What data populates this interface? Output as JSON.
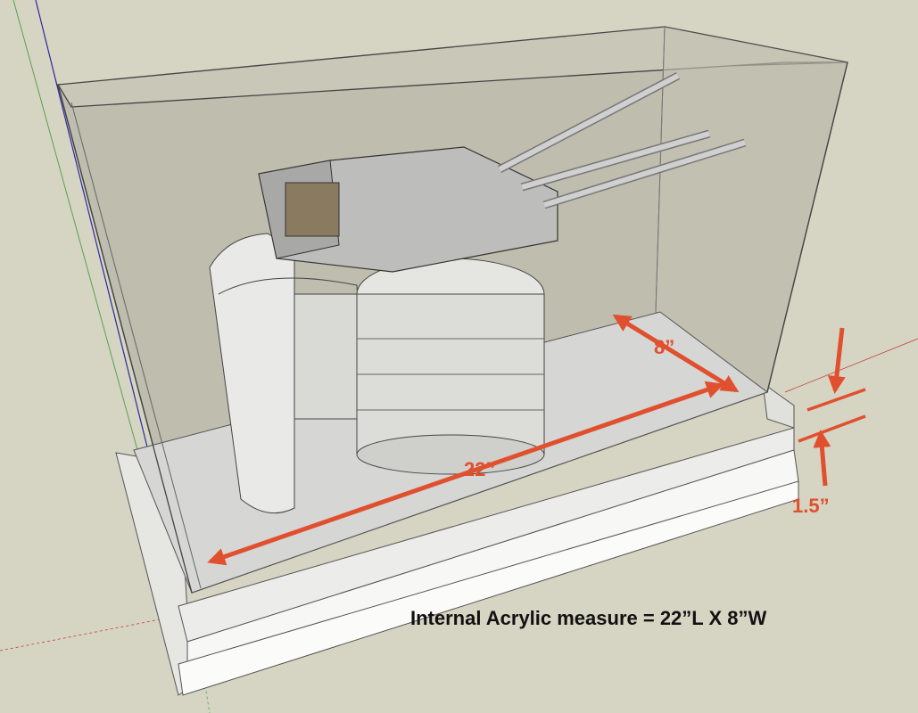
{
  "scene": {
    "length_dimension": "22”",
    "width_dimension": "8”",
    "base_height_dimension": "1.5”",
    "caption": "Internal Acrylic measure = 22”L X 8”W"
  },
  "colors": {
    "background": "#d6d4c2",
    "dimension_arrow": "#e0502e",
    "acrylic_fill": "#b9b8a8",
    "base": "#f3f3f1",
    "model_grey": "#c9c9c9"
  }
}
